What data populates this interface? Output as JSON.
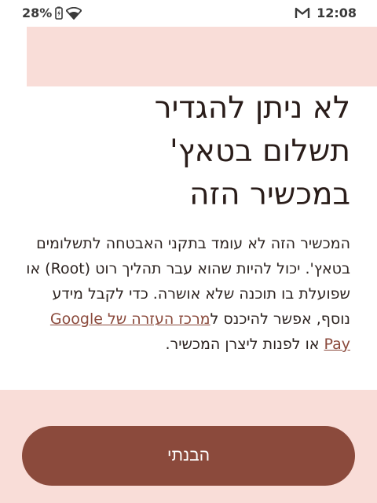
{
  "status_bar": {
    "battery_percent": "28%",
    "time": "12:08",
    "icons": [
      "battery-charging-icon",
      "wifi-icon",
      "gmail-icon"
    ]
  },
  "dialog": {
    "title_line1": "לא ניתן להגדיר",
    "title_line2": "תשלום בטאץ'",
    "title_line3": "במכשיר הזה",
    "body_part1": "המכשיר הזה לא עומד בתקני האבטחה לתשלומים בטאץ'. יכול להיות שהוא עבר תהליך רוט (Root) או שפועלת בו תוכנה שלא אושרה. כדי לקבל מידע נוסף, אפשר להיכנס ל",
    "help_link": "מרכז העזרה של Google Pay",
    "body_part2": " או לפנות ליצרן המכשיר."
  },
  "actions": {
    "primary_label": "הבנתי"
  },
  "colors": {
    "accent": "#8b4a3c",
    "surface_tint": "#f9ddd8",
    "text": "#2a1d1a"
  }
}
